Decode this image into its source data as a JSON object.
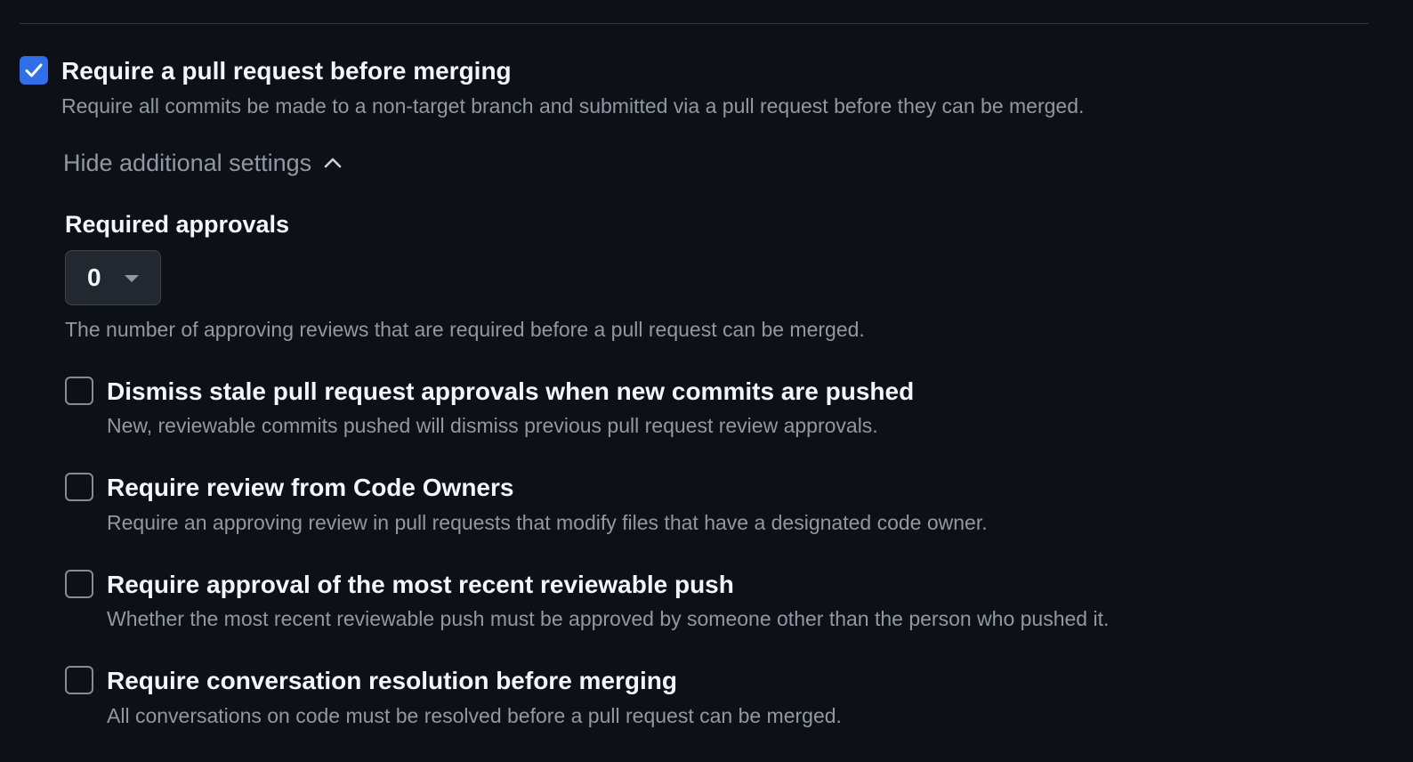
{
  "main_rule": {
    "checked": true,
    "title": "Require a pull request before merging",
    "description": "Require all commits be made to a non-target branch and submitted via a pull request before they can be merged."
  },
  "toggle": {
    "label": "Hide additional settings",
    "icon": "chevron-up-icon"
  },
  "required_approvals": {
    "label": "Required approvals",
    "value": "0",
    "description": "The number of approving reviews that are required before a pull request can be merged."
  },
  "options": [
    {
      "checked": false,
      "title": "Dismiss stale pull request approvals when new commits are pushed",
      "description": "New, reviewable commits pushed will dismiss previous pull request review approvals."
    },
    {
      "checked": false,
      "title": "Require review from Code Owners",
      "description": "Require an approving review in pull requests that modify files that have a designated code owner."
    },
    {
      "checked": false,
      "title": "Require approval of the most recent reviewable push",
      "description": "Whether the most recent reviewable push must be approved by someone other than the person who pushed it."
    },
    {
      "checked": false,
      "title": "Require conversation resolution before merging",
      "description": "All conversations on code must be resolved before a pull request can be merged."
    }
  ],
  "colors": {
    "background": "#0d1117",
    "checkbox_checked": "#2f6fe8",
    "text_primary": "#f0f6fc",
    "text_muted": "#9198a1"
  }
}
